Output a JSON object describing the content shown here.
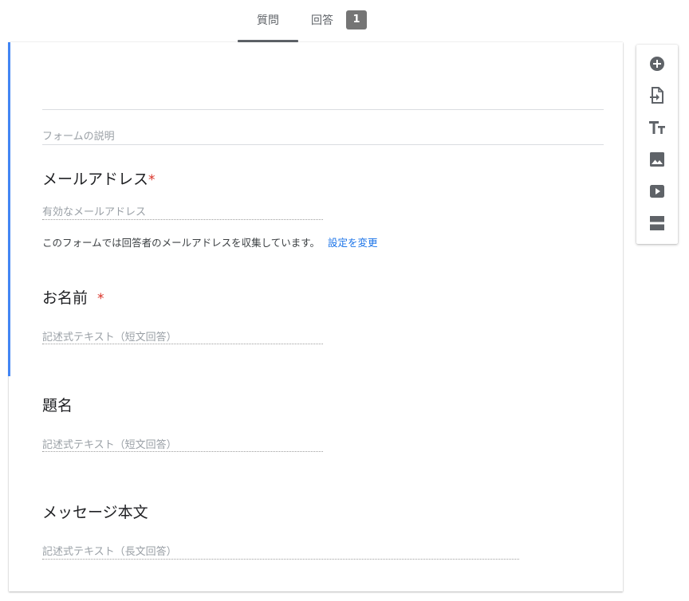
{
  "tabs": {
    "questions_label": "質問",
    "responses_label": "回答",
    "responses_count": "1"
  },
  "form": {
    "description_placeholder": "フォームの説明",
    "email": {
      "title": "メールアドレス",
      "required_mark": "*",
      "placeholder": "有効なメールアドレス",
      "notice": "このフォームでは回答者のメールアドレスを収集しています。",
      "notice_link": "設定を変更"
    },
    "questions": [
      {
        "title": "お名前",
        "required_mark": "*",
        "placeholder": "記述式テキスト（短文回答）"
      },
      {
        "title": "題名",
        "placeholder": "記述式テキスト（短文回答）"
      },
      {
        "title": "メッセージ本文",
        "placeholder": "記述式テキスト（長文回答）"
      }
    ]
  },
  "toolbar": {
    "icons": [
      "add-question-icon",
      "import-questions-icon",
      "add-title-icon",
      "add-image-icon",
      "add-video-icon",
      "add-section-icon"
    ]
  },
  "colors": {
    "accent": "#4285f4",
    "required": "#d93025",
    "link": "#1a73e8",
    "tab_active": "#5f6368",
    "badge_bg": "#757575"
  }
}
